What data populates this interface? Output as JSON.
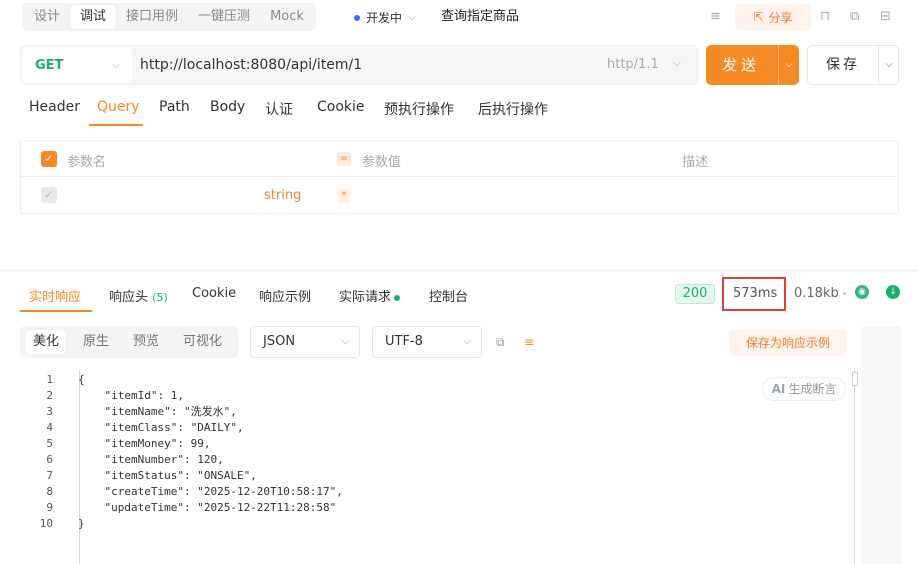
{
  "top": {
    "mode_tabs": [
      "设计",
      "调试",
      "接口用例",
      "一键压测",
      "Mock"
    ],
    "active_mode": 1,
    "environment": "开发中",
    "api_name": "查询指定商品",
    "share_label": "分享"
  },
  "request": {
    "method": "GET",
    "url": "http://localhost:8080/api/item/1",
    "http_version": "http/1.1",
    "send_label": "发送",
    "save_label": "保存",
    "tabs": [
      "Header",
      "Query",
      "Path",
      "Body",
      "认证",
      "Cookie",
      "预执行操作",
      "后执行操作"
    ],
    "active_tab": 1
  },
  "params_table": {
    "headers": {
      "name": "参数名",
      "value": "参数值",
      "desc": "描述"
    },
    "rows": [
      {
        "name": "",
        "type": "string",
        "value": "",
        "desc": ""
      }
    ]
  },
  "response": {
    "tabs": {
      "realtime": "实时响应",
      "headers": "响应头",
      "headers_count": "(5)",
      "cookie": "Cookie",
      "examples": "响应示例",
      "actual_request": "实际请求",
      "console": "控制台"
    },
    "status_code": "200",
    "time": "573ms",
    "size": "0.18kb",
    "view_tabs": [
      "美化",
      "原生",
      "预览",
      "可视化"
    ],
    "active_view": 0,
    "format": "JSON",
    "encoding": "UTF-8",
    "save_example_label": "保存为响应示例",
    "ai_label": "生成断言",
    "ai_prefix": "AI",
    "code_lines": [
      "{",
      "    \"itemId\": 1,",
      "    \"itemName\": \"洗发水\",",
      "    \"itemClass\": \"DAILY\",",
      "    \"itemMoney\": 99,",
      "    \"itemNumber\": 120,",
      "    \"itemStatus\": \"ONSALE\",",
      "    \"createTime\": \"2025-12-20T10:58:17\",",
      "    \"updateTime\": \"2025-12-22T11:28:58\"",
      "}"
    ]
  },
  "colors": {
    "accent": "#f58a25",
    "success": "#1bb06a",
    "highlight_box": "#e2413a"
  },
  "icons": {
    "environment_dot": "status-dot",
    "share": "share-icon",
    "globe": "globe-icon",
    "download": "download-icon"
  }
}
